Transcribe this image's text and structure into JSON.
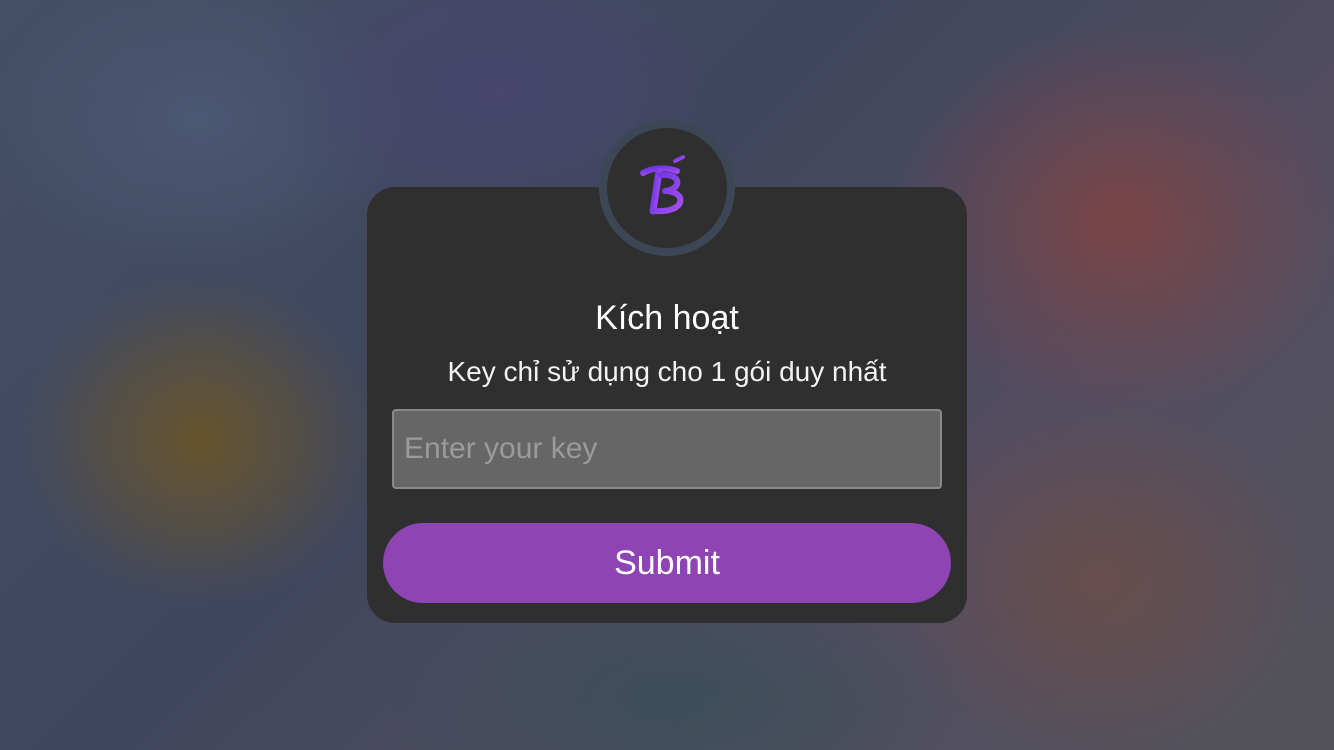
{
  "dialog": {
    "title": "Kích hoạt",
    "subtitle": "Key chỉ sử dụng cho 1 gói duy nhất",
    "input": {
      "placeholder": "Enter your key",
      "value": ""
    },
    "submit_label": "Submit",
    "logo_icon": "app-logo-icon"
  },
  "colors": {
    "card_background": "#2f2f2f",
    "accent": "#8e44b2",
    "logo_gradient_start": "#7b3fe4",
    "logo_gradient_end": "#a855f7",
    "input_background": "#666666"
  }
}
